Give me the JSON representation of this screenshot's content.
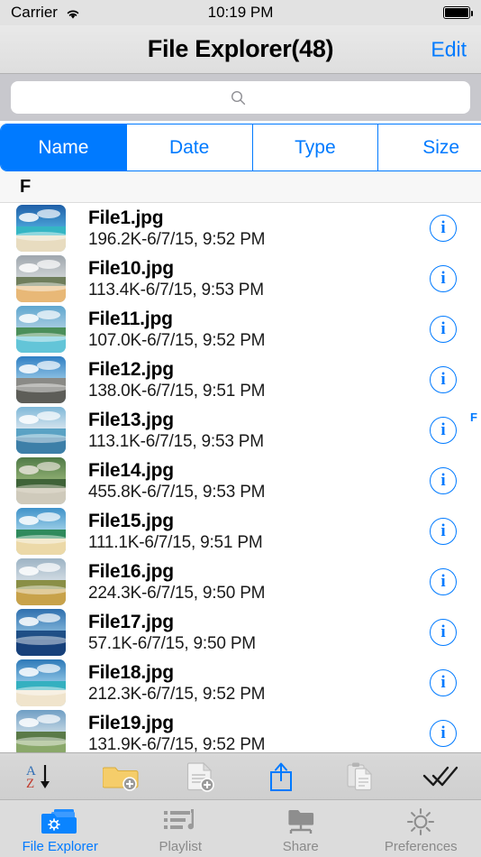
{
  "status_bar": {
    "carrier": "Carrier",
    "wifi_icon": "wifi-icon",
    "time": "10:19 PM",
    "battery_icon": "battery-full-icon",
    "battery_level": 100
  },
  "nav_bar": {
    "title": "File Explorer(48)",
    "edit_label": "Edit"
  },
  "search": {
    "value": "",
    "placeholder": "",
    "icon": "search-icon"
  },
  "segmented_control": {
    "selected_index": 0,
    "accent_color": "#007aff",
    "options": [
      {
        "label": "Name",
        "selected": true
      },
      {
        "label": "Date",
        "selected": false
      },
      {
        "label": "Type",
        "selected": false
      },
      {
        "label": "Size",
        "selected": false
      }
    ]
  },
  "list": {
    "section_header": "F",
    "section_index": [
      "F"
    ],
    "info_icon": "info-icon",
    "rows": [
      {
        "name": "File1.jpg",
        "meta": "196.2K-6/7/15, 9:52 PM",
        "size": "196.2K",
        "date": "6/7/15, 9:52 PM",
        "thumb": "beach-turquoise"
      },
      {
        "name": "File10.jpg",
        "meta": "113.4K-6/7/15, 9:53 PM",
        "size": "113.4K",
        "date": "6/7/15, 9:53 PM",
        "thumb": "beach-dunes"
      },
      {
        "name": "File11.jpg",
        "meta": "107.0K-6/7/15, 9:52 PM",
        "size": "107.0K",
        "date": "6/7/15, 9:52 PM",
        "thumb": "coastline-aerial"
      },
      {
        "name": "File12.jpg",
        "meta": "138.0K-6/7/15, 9:51 PM",
        "size": "138.0K",
        "date": "6/7/15, 9:51 PM",
        "thumb": "city-street"
      },
      {
        "name": "File13.jpg",
        "meta": "113.1K-6/7/15, 9:53 PM",
        "size": "113.1K",
        "date": "6/7/15, 9:53 PM",
        "thumb": "sailboat-sea"
      },
      {
        "name": "File14.jpg",
        "meta": "455.8K-6/7/15, 9:53 PM",
        "size": "455.8K",
        "date": "6/7/15, 9:53 PM",
        "thumb": "statue-garden"
      },
      {
        "name": "File15.jpg",
        "meta": "111.1K-6/7/15, 9:51 PM",
        "size": "111.1K",
        "date": "6/7/15, 9:51 PM",
        "thumb": "palm-beach"
      },
      {
        "name": "File16.jpg",
        "meta": "224.3K-6/7/15, 9:50 PM",
        "size": "224.3K",
        "date": "6/7/15, 9:50 PM",
        "thumb": "golden-field"
      },
      {
        "name": "File17.jpg",
        "meta": "57.1K-6/7/15, 9:50 PM",
        "size": "57.1K",
        "date": "6/7/15, 9:50 PM",
        "thumb": "deep-blue-bay"
      },
      {
        "name": "File18.jpg",
        "meta": "212.3K-6/7/15, 9:52 PM",
        "size": "212.3K",
        "date": "6/7/15, 9:52 PM",
        "thumb": "white-sand-beach"
      },
      {
        "name": "File19.jpg",
        "meta": "131.9K-6/7/15, 9:52 PM",
        "size": "131.9K",
        "date": "6/7/15, 9:52 PM",
        "thumb": "rainbow-hill"
      }
    ]
  },
  "toolbar": {
    "buttons": [
      {
        "name": "sort-az-button",
        "icon": "sort-az-icon",
        "enabled": true
      },
      {
        "name": "new-folder-button",
        "icon": "new-folder-icon",
        "enabled": true
      },
      {
        "name": "new-file-button",
        "icon": "new-file-icon",
        "enabled": true
      },
      {
        "name": "share-button",
        "icon": "share-icon",
        "enabled": true
      },
      {
        "name": "paste-button",
        "icon": "paste-icon",
        "enabled": false
      },
      {
        "name": "select-all-button",
        "icon": "double-check-icon",
        "enabled": true
      }
    ]
  },
  "tab_bar": {
    "active_index": 0,
    "active_color": "#007aff",
    "inactive_color": "#8a8a8a",
    "tabs": [
      {
        "label": "File Explorer",
        "icon": "folder-gear-icon",
        "active": true
      },
      {
        "label": "Playlist",
        "icon": "playlist-music-icon",
        "active": false
      },
      {
        "label": "Share",
        "icon": "network-share-icon",
        "active": false
      },
      {
        "label": "Preferences",
        "icon": "gear-sun-icon",
        "active": false
      }
    ]
  }
}
